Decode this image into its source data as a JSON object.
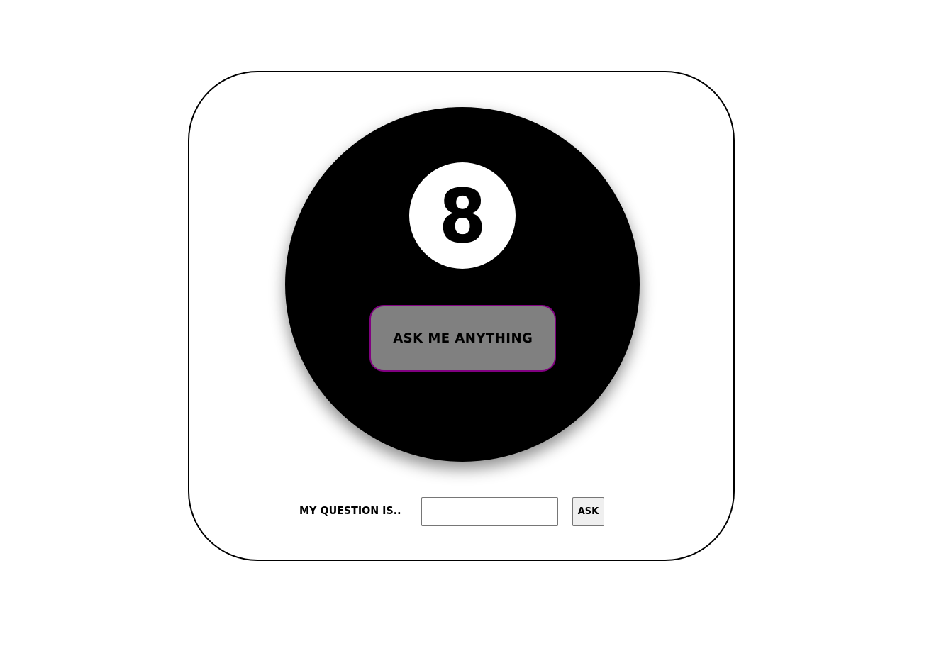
{
  "eight_ball": {
    "number": "8",
    "answer_text": "ASK ME ANYTHING"
  },
  "question_form": {
    "label": "MY QUESTION IS..",
    "input_value": "",
    "input_placeholder": "",
    "submit_label": "ASK"
  },
  "colors": {
    "ball": "#000000",
    "number_circle": "#ffffff",
    "answer_background": "#808080",
    "answer_border": "#800080",
    "frame_border": "#000000"
  }
}
